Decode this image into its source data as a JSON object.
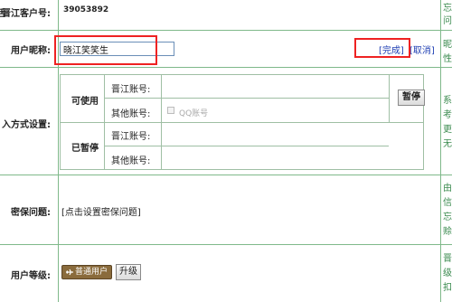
{
  "rows": {
    "customer_id": {
      "label": "晋江客户号:",
      "value": "39053892"
    },
    "nickname": {
      "label": "用户昵称:",
      "value": "晓江笑笑生",
      "done_link": "[完成]",
      "cancel_link": "[取消]"
    },
    "login": {
      "label": "入方式设置:",
      "usable_label": "可使用",
      "paused_label": "已暂停",
      "jj_account_label": "晋江账号:",
      "other_account_label": "其他账号:",
      "qq_label": "QQ账号",
      "pause_button": "暂停"
    },
    "security": {
      "label": "密保问题:",
      "link": "[点击设置密保问题]"
    },
    "level": {
      "label": "用户等级:",
      "badge": "普通用户",
      "upgrade_button": "升级"
    }
  },
  "left_edge_fragment": "舌",
  "right_column": [
    "忘",
    "问",
    "昵",
    "性",
    "系",
    "考",
    "更",
    "无",
    "由",
    "信",
    "忘",
    "赊",
    "晋",
    "级",
    "扣"
  ]
}
